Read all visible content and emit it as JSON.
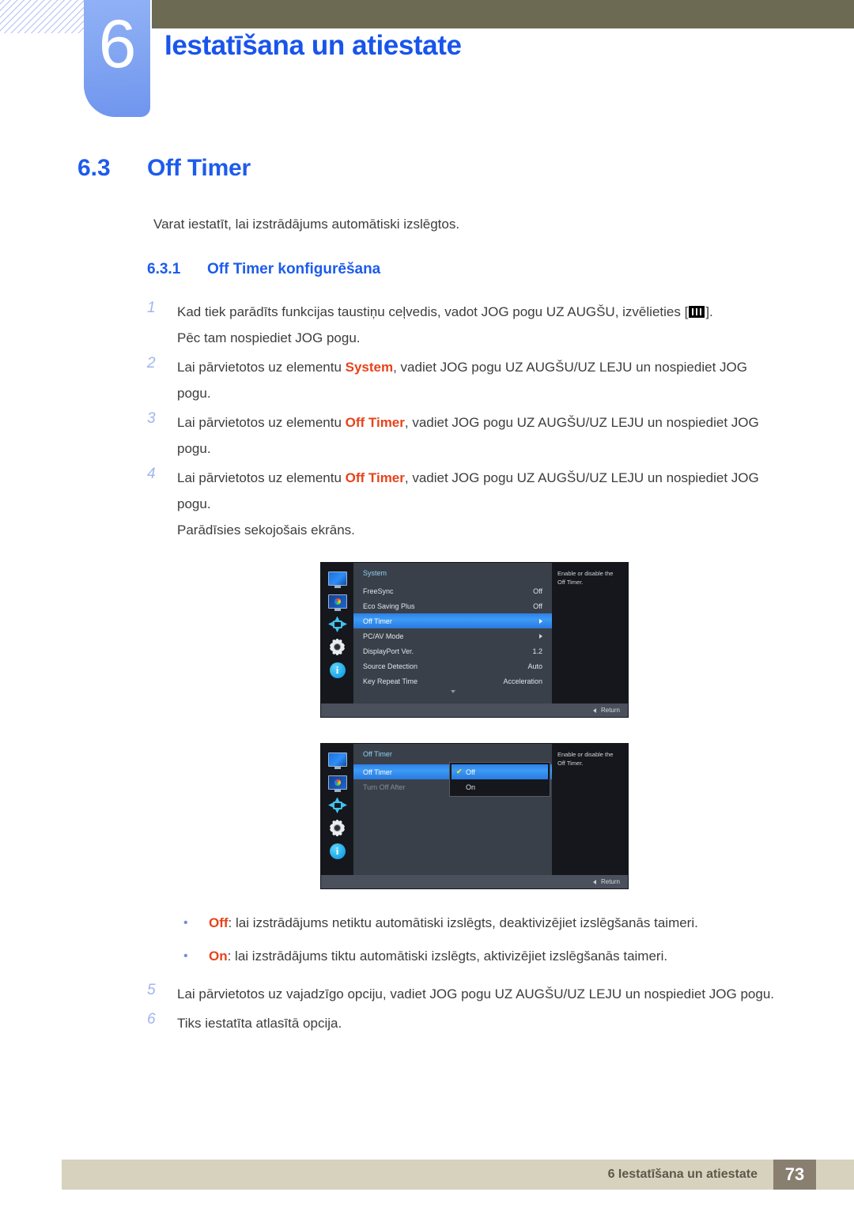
{
  "header": {
    "chapter_number": "6",
    "chapter_title": "Iestatīšana un atiestate"
  },
  "section": {
    "number": "6.3",
    "title": "Off Timer",
    "intro": "Varat iestatīt, lai izstrādājums automātiski izslēgtos."
  },
  "subsection": {
    "number": "6.3.1",
    "title": "Off Timer konfigurēšana"
  },
  "steps": [
    {
      "num": "1",
      "text_before": "Kad tiek parādīts funkcijas taustiņu ceļvedis, vadot JOG pogu UZ AUGŠU, izvēlieties [",
      "text_after": "].",
      "continuation": "Pēc tam nospiediet JOG pogu."
    },
    {
      "num": "2",
      "text_before": "Lai pārvietotos uz elementu ",
      "highlight": "System",
      "text_after": ", vadiet JOG pogu UZ AUGŠU/UZ LEJU un nospiediet JOG pogu."
    },
    {
      "num": "3",
      "text_before": "Lai pārvietotos uz elementu ",
      "highlight": "Off Timer",
      "text_after": ", vadiet JOG pogu UZ AUGŠU/UZ LEJU un nospiediet JOG pogu."
    },
    {
      "num": "4",
      "text_before": "Lai pārvietotos uz elementu ",
      "highlight": "Off Timer",
      "text_after": ", vadiet JOG pogu UZ AUGŠU/UZ LEJU un nospiediet JOG pogu.",
      "continuation": "Parādīsies sekojošais ekrāns."
    }
  ],
  "tail_steps": [
    {
      "num": "5",
      "text": "Lai pārvietotos uz vajadzīgo opciju, vadiet JOG pogu UZ AUGŠU/UZ LEJU un nospiediet JOG pogu."
    },
    {
      "num": "6",
      "text": "Tiks iestatīta atlasītā opcija."
    }
  ],
  "bullets": [
    {
      "bullet": "•",
      "highlight": "Off",
      "text": ": lai izstrādājums netiktu automātiski izslēgts, deaktivizējiet izslēgšanās taimeri."
    },
    {
      "bullet": "•",
      "highlight": "On",
      "text": ": lai izstrādājums tiktu automātiski izslēgts, aktivizējiet izslēgšanās taimeri."
    }
  ],
  "osd_screens": [
    {
      "panel_title": "System",
      "rail_icons": [
        "monitor-icon",
        "picture-color-icon",
        "screen-adjust-icon",
        "gear-icon",
        "info-icon"
      ],
      "rows": [
        {
          "label": "FreeSync",
          "value": "Off",
          "selected": false,
          "arrow": false
        },
        {
          "label": "Eco Saving Plus",
          "value": "Off",
          "selected": false,
          "arrow": false
        },
        {
          "label": "Off Timer",
          "value": "",
          "selected": true,
          "arrow": true
        },
        {
          "label": "PC/AV Mode",
          "value": "",
          "selected": false,
          "arrow": true
        },
        {
          "label": "DisplayPort Ver.",
          "value": "1.2",
          "selected": false,
          "arrow": false
        },
        {
          "label": "Source Detection",
          "value": "Auto",
          "selected": false,
          "arrow": false
        },
        {
          "label": "Key Repeat Time",
          "value": "Acceleration",
          "selected": false,
          "arrow": false
        }
      ],
      "has_scroll_caret": true,
      "description": "Enable or disable the Off Timer.",
      "return_label": "Return"
    },
    {
      "panel_title": "Off Timer",
      "rail_icons": [
        "monitor-icon",
        "picture-color-icon",
        "screen-adjust-icon",
        "gear-icon",
        "info-icon"
      ],
      "rows": [
        {
          "label": "Off Timer",
          "value": "",
          "selected": true,
          "arrow": false
        },
        {
          "label": "Turn Off After",
          "value": "",
          "selected": false,
          "dim": true,
          "arrow": false
        }
      ],
      "dropdown": {
        "options": [
          {
            "label": "Off",
            "checked": true,
            "check_glyph": "✔"
          },
          {
            "label": "On",
            "checked": false,
            "check_glyph": ""
          }
        ]
      },
      "description": "Enable or disable the Off Timer.",
      "return_label": "Return"
    }
  ],
  "footer": {
    "text": "6 Iestatīšana un atiestate",
    "page": "73"
  },
  "colors": {
    "accent_blue": "#1d5bec",
    "badge_blue": "#83a6f2",
    "highlight_orange": "#e8421a",
    "header_olive": "#6d6a54",
    "footer_tan": "#d7d2bd",
    "footer_page_brown": "#897f70",
    "osd_select_blue": "#3c9bf5"
  }
}
